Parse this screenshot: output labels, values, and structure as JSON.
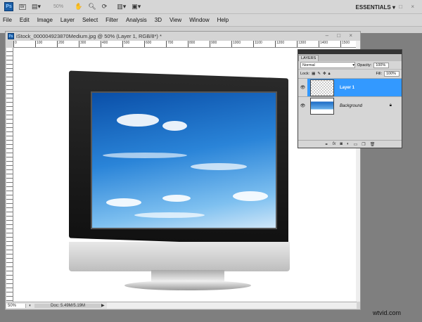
{
  "appbar": {
    "logo": "Ps",
    "bridge": "Br",
    "zoom": "50%",
    "workspace": "ESSENTIALS ▾",
    "window_controls": "– □ ×"
  },
  "menu": [
    "File",
    "Edit",
    "Image",
    "Layer",
    "Select",
    "Filter",
    "Analysis",
    "3D",
    "View",
    "Window",
    "Help"
  ],
  "document": {
    "title": "iStock_000004923870Medium.jpg @ 50% (Layer 1, RGB/8*) *",
    "controls": "– □ ×",
    "ruler": [
      "0",
      "100",
      "200",
      "300",
      "400",
      "500",
      "600",
      "700",
      "800",
      "900",
      "1000",
      "1100",
      "1200",
      "1300",
      "1400",
      "1500"
    ],
    "status": {
      "zoom": "50%",
      "doc": "Doc: 5.49M/5.19M"
    }
  },
  "layers_panel": {
    "tab": "LAYERS",
    "blend_mode": "Normal",
    "opacity_label": "Opacity:",
    "opacity": "100%",
    "lock_label": "Lock:",
    "fill_label": "Fill:",
    "fill": "100%",
    "layers": [
      {
        "name": "Layer 1",
        "selected": true
      },
      {
        "name": "Background",
        "locked": true
      }
    ],
    "footer_icons": [
      "link-icon",
      "fx-icon",
      "mask-icon",
      "adjustment-icon",
      "group-icon",
      "new-layer-icon",
      "trash-icon"
    ]
  },
  "watermark": "wtvid.com",
  "colors": {
    "selection": "#3399ff",
    "workspace": "#7f7f7f"
  }
}
